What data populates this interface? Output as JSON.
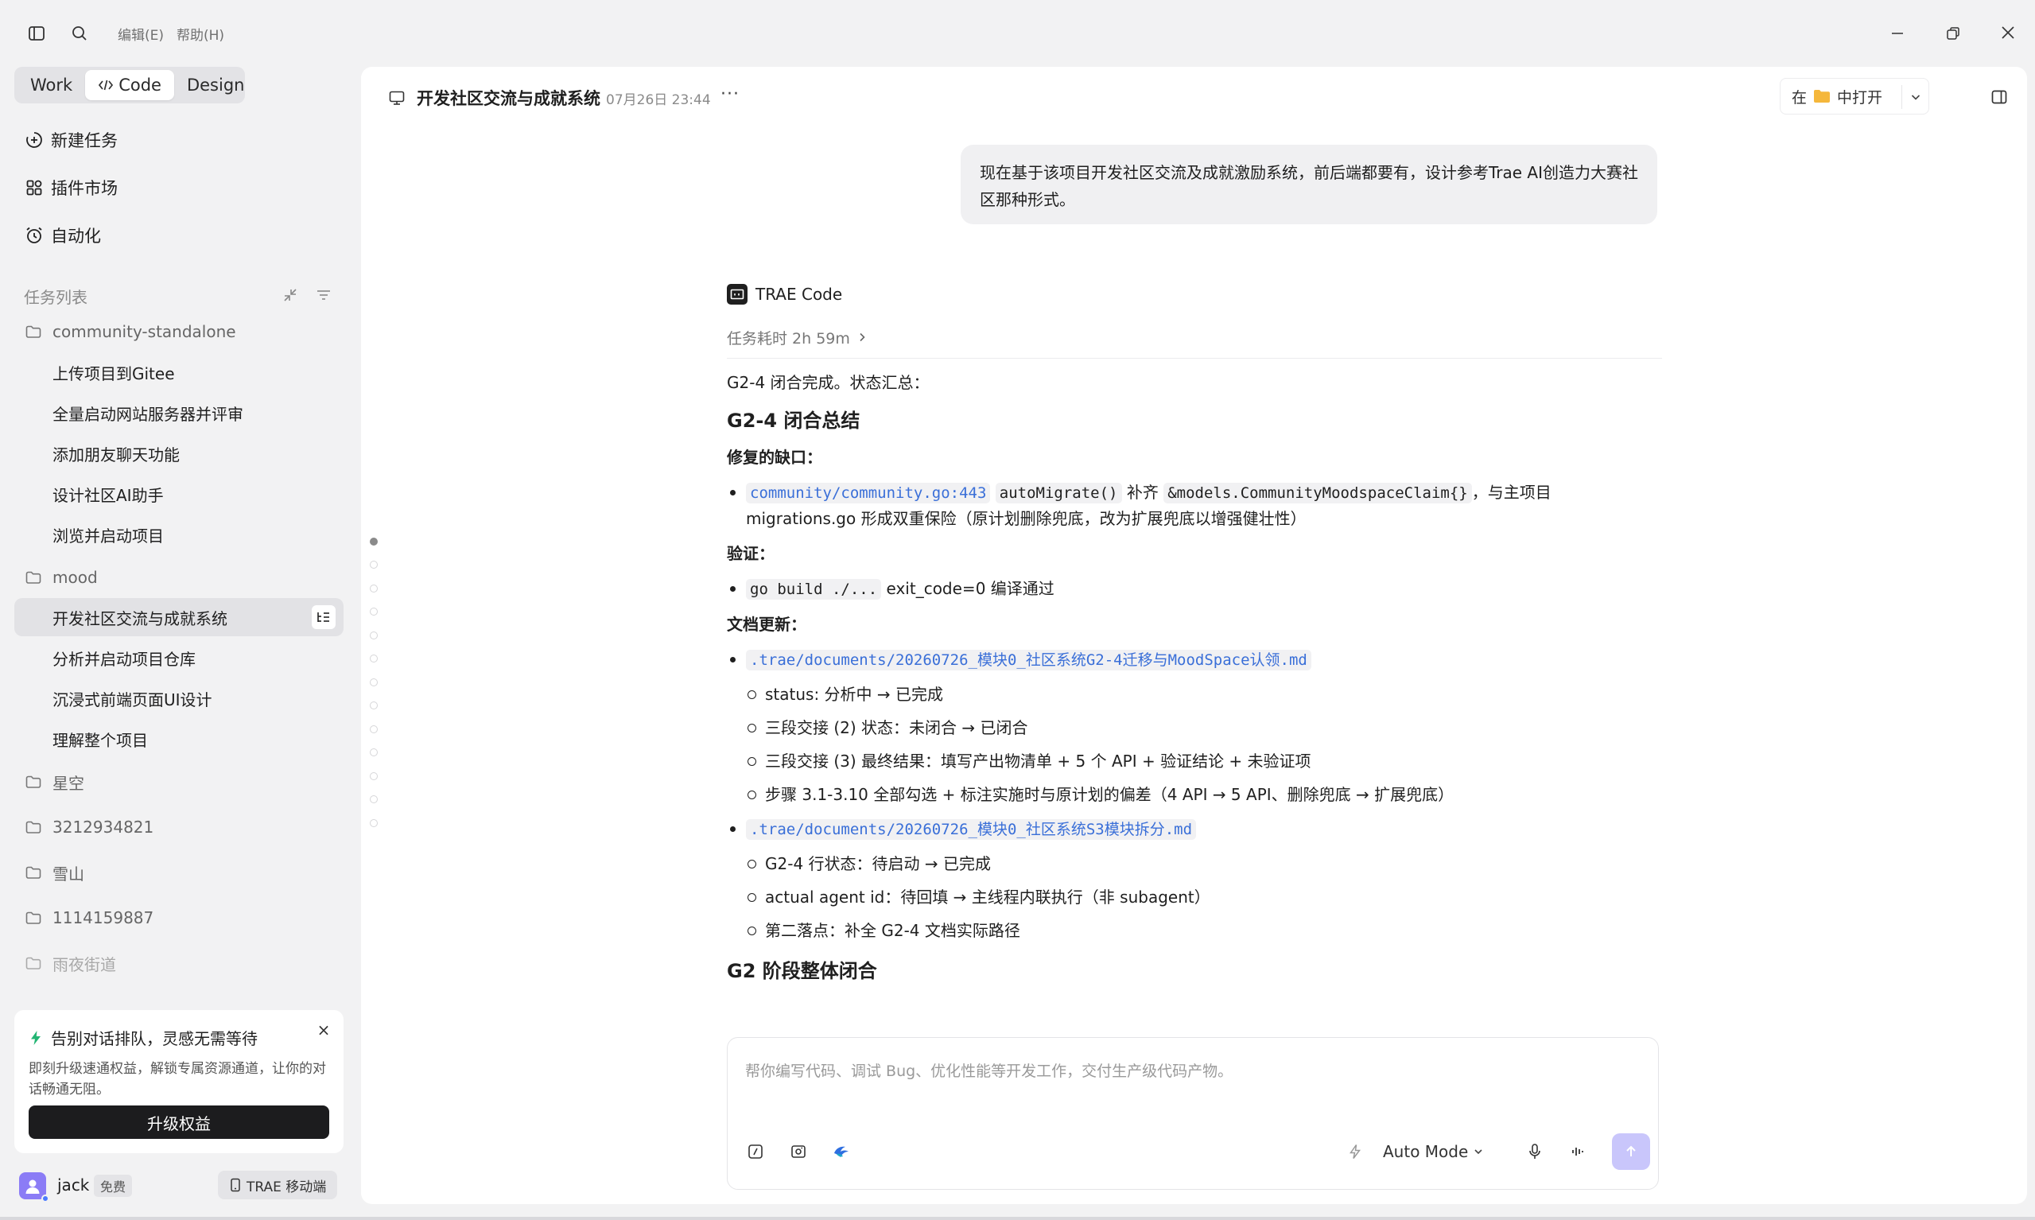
{
  "titlebar": {
    "menu_edit": "编辑(E)",
    "menu_help": "帮助(H)"
  },
  "sidebar": {
    "modes": [
      {
        "label": "Work"
      },
      {
        "label": "Code",
        "icon": "code-icon"
      },
      {
        "label": "Design"
      }
    ],
    "active_mode": "Code",
    "nav": {
      "new_task": "新建任务",
      "plugins": "插件市场",
      "automation": "自动化"
    },
    "tasklist_title": "任务列表",
    "folders": {
      "f1": "community-standalone",
      "f2": "mood",
      "f3": "星空",
      "f4": "3212934821",
      "f5": "雪山",
      "f6": "1114159887",
      "f7": "雨夜街道"
    },
    "tasks": {
      "t1": "上传项目到Gitee",
      "t2": "全量启动网站服务器并评审",
      "t3": "添加朋友聊天功能",
      "t4": "设计社区AI助手",
      "t5": "浏览并启动项目",
      "t6": "开发社区交流与成就系统",
      "t7": "分析并启动项目仓库",
      "t8": "沉浸式前端页面UI设计",
      "t9": "理解整个项目"
    },
    "promo": {
      "title": "告别对话排队，灵感无需等待",
      "desc": "即刻升级速通权益，解锁专属资源通道，让你的对话畅通无阻。",
      "button": "升级权益",
      "close": "×"
    },
    "user": {
      "name": "jack",
      "plan": "免费",
      "mobile": "TRAE 移动端"
    }
  },
  "chat": {
    "title": "开发社区交流与成就系统",
    "time": "07月26日 23:44",
    "more": "···",
    "open_in_prefix": "在",
    "open_in_suffix": "中打开",
    "user_message": "现在基于该项目开发社区交流及成就激励系统，前后端都要有，设计参考Trae AI创造力大赛社区那种形式。",
    "agent_name": "TRAE Code",
    "duration": "任务耗时 2h 59m",
    "answer": {
      "intro": "G2-4 闭合完成。状态汇总：",
      "h_summary": "G2-4 闭合总结",
      "s_fix": "修复的缺口：",
      "fix_code1": "community/community.go:443",
      "fix_code2": "autoMigrate()",
      "fix_mid": " 补齐 ",
      "fix_code3": "&models.CommunityMoodspaceClaim{}",
      "fix_text": "，与主项目 migrations.go 形成双重保险（原计划删除兜底，改为扩展兜底以增强健壮性）",
      "s_verify": "验证：",
      "verify_code": "go build ./...",
      "verify_text": " exit_code=0 编译通过",
      "s_docs": "文档更新：",
      "doc1": ".trae/documents/20260726_模块0_社区系统G2-4迁移与MoodSpace认领.md",
      "doc1_items": {
        "a": "status: 分析中 → 已完成",
        "b": "三段交接 (2) 状态：未闭合 → 已闭合",
        "c": "三段交接 (3) 最终结果：填写产出物清单 + 5 个 API + 验证结论 + 未验证项",
        "d": "步骤 3.1-3.10 全部勾选 + 标注实施时与原计划的偏差（4 API → 5 API、删除兜底 → 扩展兜底）"
      },
      "doc2": ".trae/documents/20260726_模块0_社区系统S3模块拆分.md",
      "doc2_items": {
        "a": "G2-4 行状态：待启动 → 已完成",
        "b": "actual agent id：待回填 → 主线程内联执行（非 subagent）",
        "c": "第二落点：补全 G2-4 文档实际路径"
      },
      "h_g2": "G2 阶段整体闭合"
    }
  },
  "composer": {
    "placeholder": "帮你编写代码、调试 Bug、优化性能等开发工作，交付生产级代码产物。",
    "mode": "Auto Mode"
  },
  "colors": {
    "accent": "#3a6fd8",
    "send_button": "#c9c6fb",
    "avatar": "#8b7cf6",
    "promo_icon": "#22b573",
    "folder_icon": "#f5b73b"
  }
}
